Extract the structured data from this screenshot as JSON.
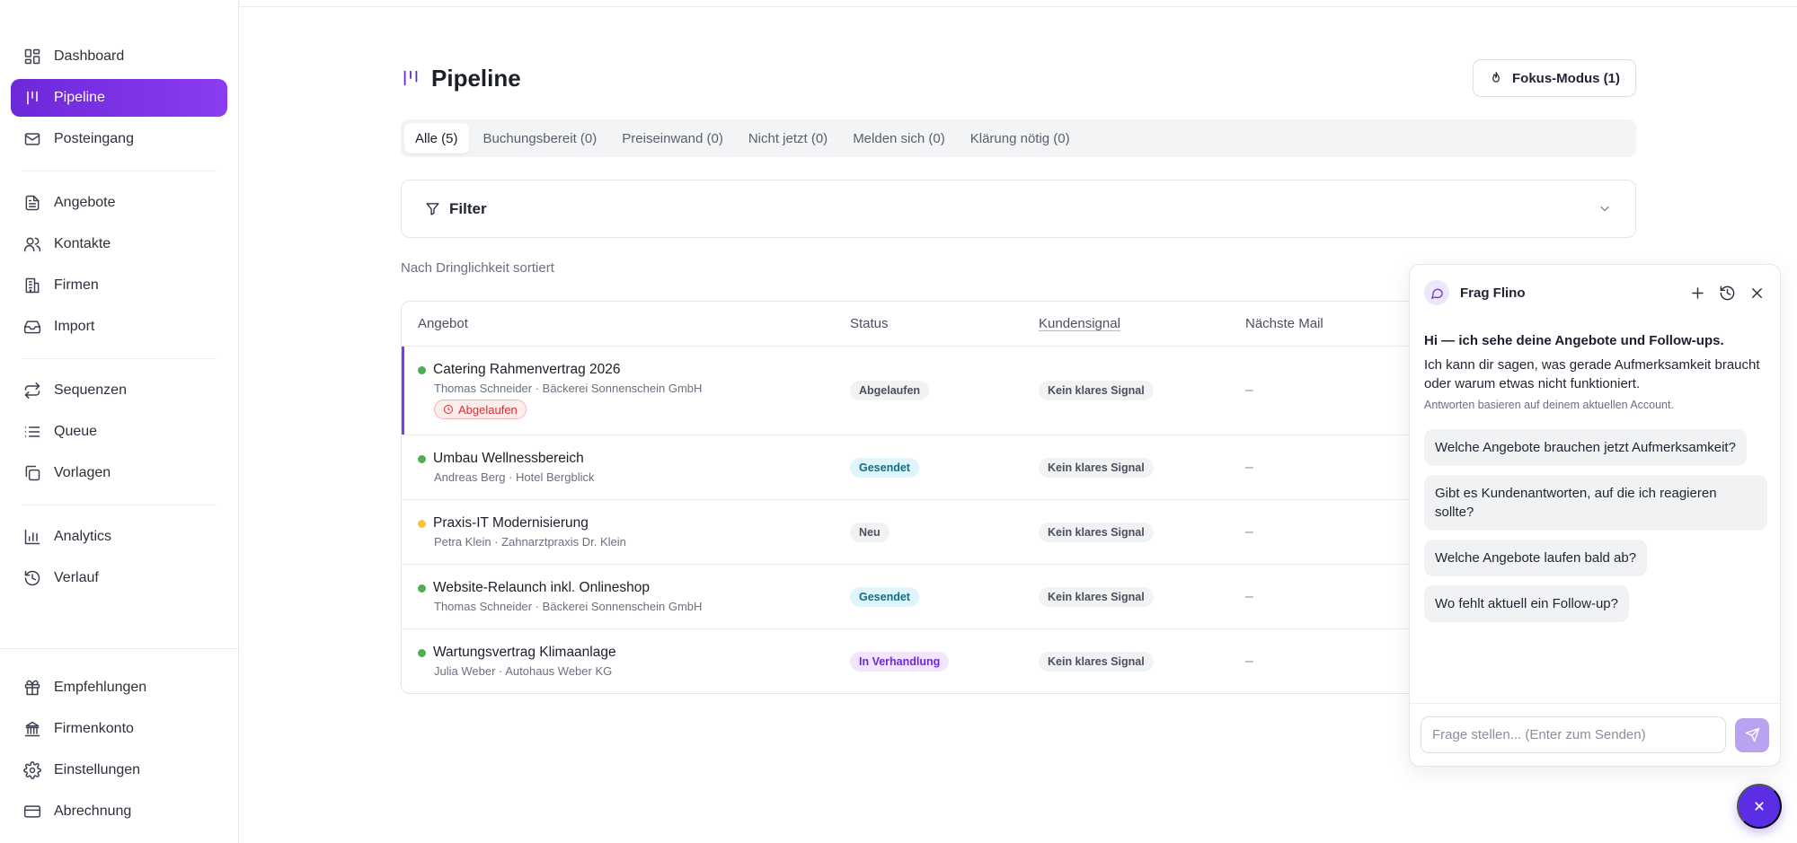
{
  "sidebar": {
    "group1": [
      {
        "label": "Dashboard",
        "icon": "dashboard-icon"
      },
      {
        "label": "Pipeline",
        "icon": "pipeline-icon"
      },
      {
        "label": "Posteingang",
        "icon": "mail-icon"
      }
    ],
    "group2": [
      {
        "label": "Angebote",
        "icon": "document-icon"
      },
      {
        "label": "Kontakte",
        "icon": "users-icon"
      },
      {
        "label": "Firmen",
        "icon": "building-icon"
      },
      {
        "label": "Import",
        "icon": "inbox-icon"
      }
    ],
    "group3": [
      {
        "label": "Sequenzen",
        "icon": "repeat-icon"
      },
      {
        "label": "Queue",
        "icon": "list-icon"
      },
      {
        "label": "Vorlagen",
        "icon": "copy-icon"
      }
    ],
    "group4": [
      {
        "label": "Analytics",
        "icon": "bar-chart-icon"
      },
      {
        "label": "Verlauf",
        "icon": "history-icon"
      }
    ],
    "bottom": [
      {
        "label": "Empfehlungen",
        "icon": "gift-icon"
      },
      {
        "label": "Firmenkonto",
        "icon": "bank-icon"
      },
      {
        "label": "Einstellungen",
        "icon": "gear-icon"
      },
      {
        "label": "Abrechnung",
        "icon": "credit-card-icon"
      }
    ]
  },
  "header": {
    "title": "Pipeline",
    "focus_button": "Fokus-Modus (1)"
  },
  "tabs": [
    "Alle (5)",
    "Buchungsbereit (0)",
    "Preiseinwand (0)",
    "Nicht jetzt (0)",
    "Melden sich (0)",
    "Klärung nötig (0)"
  ],
  "filter": {
    "label": "Filter"
  },
  "sort_label": "Nach Dringlichkeit sortiert",
  "table": {
    "columns": [
      "Angebot",
      "Status",
      "Kundensignal",
      "Nächste Mail"
    ],
    "rows": [
      {
        "title": "Catering Rahmenvertrag 2026",
        "sub": "Thomas Schneider · Bäckerei Sonnenschein GmbH",
        "badge": "Abgelaufen",
        "status": "Abgelaufen",
        "signal": "Kein klares Signal",
        "next": "–"
      },
      {
        "title": "Umbau Wellnessbereich",
        "sub": "Andreas Berg · Hotel Bergblick",
        "status": "Gesendet",
        "signal": "Kein klares Signal",
        "next": "–"
      },
      {
        "title": "Praxis-IT Modernisierung",
        "sub": "Petra Klein · Zahnarztpraxis Dr. Klein",
        "status": "Neu",
        "signal": "Kein klares Signal",
        "next": "–"
      },
      {
        "title": "Website-Relaunch inkl. Onlineshop",
        "sub": "Thomas Schneider · Bäckerei Sonnenschein GmbH",
        "status": "Gesendet",
        "signal": "Kein klares Signal",
        "next": "–"
      },
      {
        "title": "Wartungsvertrag Klimaanlage",
        "sub": "Julia Weber · Autohaus Weber KG",
        "status": "In Verhandlung",
        "signal": "Kein klares Signal",
        "next": "–"
      }
    ]
  },
  "colors": {
    "accent": "#6d28d9",
    "dot_green": "#4caf50",
    "dot_yellow": "#f2c53d",
    "status_sent_bg": "#e0f5fb",
    "status_sent_fg": "#0f6e83",
    "status_negotiation_bg": "#f1e6fd",
    "status_negotiation_fg": "#6d28d9"
  },
  "chat": {
    "title": "Frag Flino",
    "intro_strong": "Hi — ich sehe deine Angebote und Follow-ups.",
    "intro_text": "Ich kann dir sagen, was gerade Aufmerksamkeit braucht oder warum etwas nicht funktioniert.",
    "intro_note": "Antworten basieren auf deinem aktuellen Account.",
    "suggestions": [
      "Welche Angebote brauchen jetzt Aufmerksamkeit?",
      "Gibt es Kundenantworten, auf die ich reagieren sollte?",
      "Welche Angebote laufen bald ab?",
      "Wo fehlt aktuell ein Follow-up?"
    ],
    "input_placeholder": "Frage stellen... (Enter zum Senden)"
  }
}
